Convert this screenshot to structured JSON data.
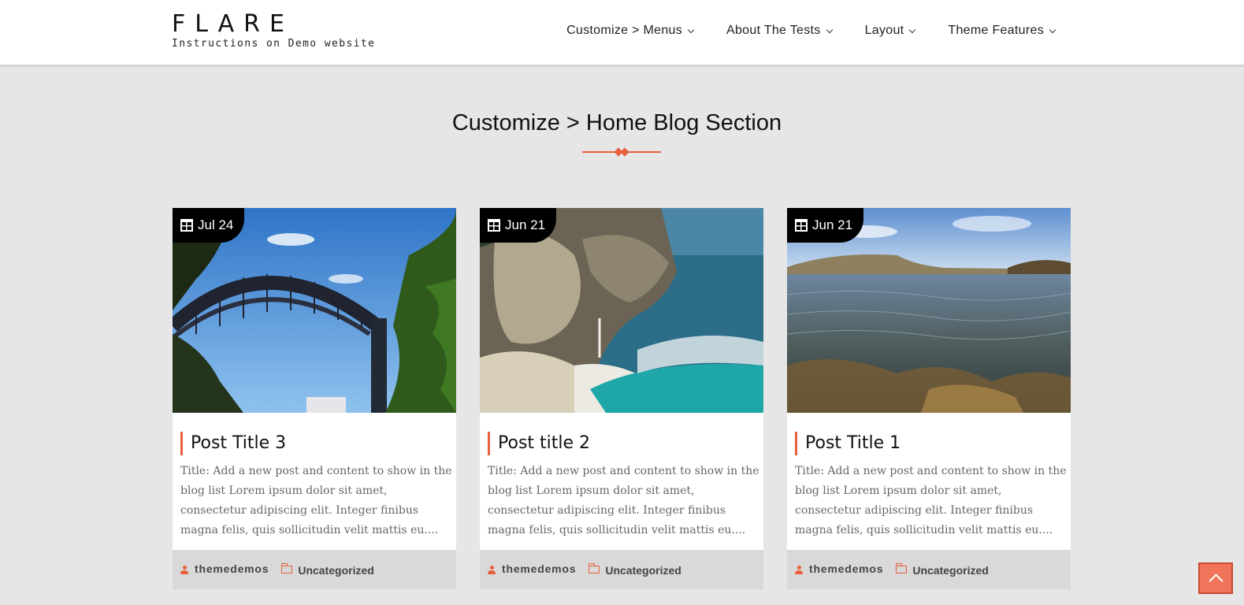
{
  "site": {
    "title": "FLARE",
    "tagline": "Instructions on Demo website"
  },
  "nav": {
    "items": [
      {
        "label": "Customize > Menus",
        "icon": "chevron-down-icon"
      },
      {
        "label": "About The Tests",
        "icon": "chevron-down-icon"
      },
      {
        "label": "Layout",
        "icon": "chevron-down-icon"
      },
      {
        "label": "Theme Features",
        "icon": "chevron-down-icon"
      }
    ]
  },
  "section": {
    "title": "Customize > Home Blog Section"
  },
  "posts": [
    {
      "date": "Jul 24",
      "title": "Post Title 3",
      "excerpt": "Title: Add a new post and content to show in the blog list Lorem ipsum dolor sit amet, consectetur adipiscing elit. Integer finibus magna felis, quis sollicitudin velit mattis eu....",
      "author": "themedemos",
      "category": "Uncategorized",
      "image": "harbour-bridge-photo"
    },
    {
      "date": "Jun 21",
      "title": "Post title 2",
      "excerpt": "Title: Add a new post and content to show in the blog list Lorem ipsum dolor sit amet, consectetur adipiscing elit. Integer finibus magna felis, quis sollicitudin velit mattis eu....",
      "author": "themedemos",
      "category": "Uncategorized",
      "image": "coastal-waterfall-photo"
    },
    {
      "date": "Jun 21",
      "title": "Post Title 1",
      "excerpt": "Title: Add a new post and content to show in the blog list Lorem ipsum dolor sit amet, consectetur adipiscing elit. Integer finibus magna felis, quis sollicitudin velit mattis eu....",
      "author": "themedemos",
      "category": "Uncategorized",
      "image": "sea-water-photo"
    }
  ],
  "colors": {
    "accent": "#e8603c",
    "background": "#e6e6e6",
    "meta_bar": "#d9d9d9"
  },
  "icons": {
    "date": "calendar-icon",
    "author": "user-icon",
    "category": "folder-open-icon",
    "scroll_top": "chevron-up-icon"
  }
}
